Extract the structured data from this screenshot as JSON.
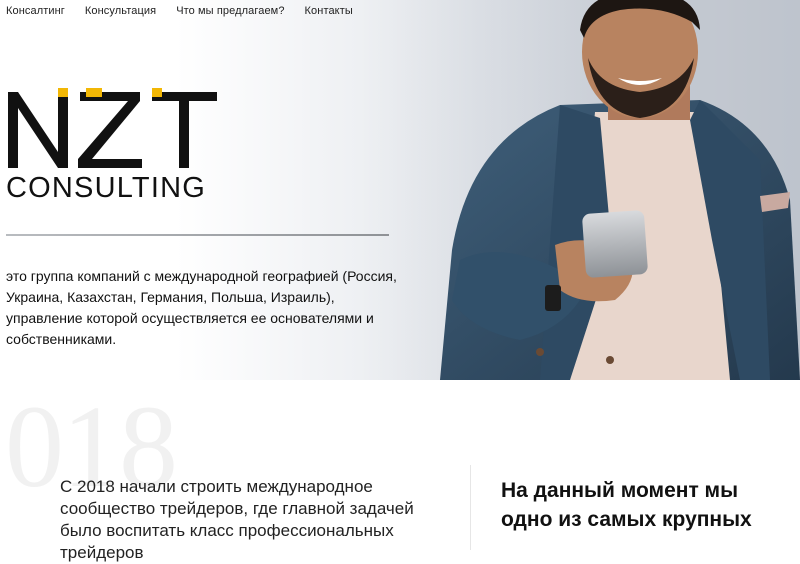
{
  "nav": {
    "items": [
      "Консалтинг",
      "Консультация",
      "Что мы предлагаем?",
      "Контакты"
    ]
  },
  "logo": {
    "mark": "NZT",
    "subtitle": "CONSULTING",
    "accent_color": "#f2b705",
    "ink_color": "#111111"
  },
  "hero": {
    "description": "это группа компаний с международной географией (Россия, Украина, Казахстан, Германия, Польша, Израиль), управление которой осуществляется ее основателями и собственниками."
  },
  "about": {
    "year_watermark": "018",
    "history_text": "С 2018 начали строить международное сообщество трейдеров, где главной задачей было воспитать класс профессиональных трейдеров",
    "position_heading": "На данный момент мы одно из самых крупных"
  }
}
